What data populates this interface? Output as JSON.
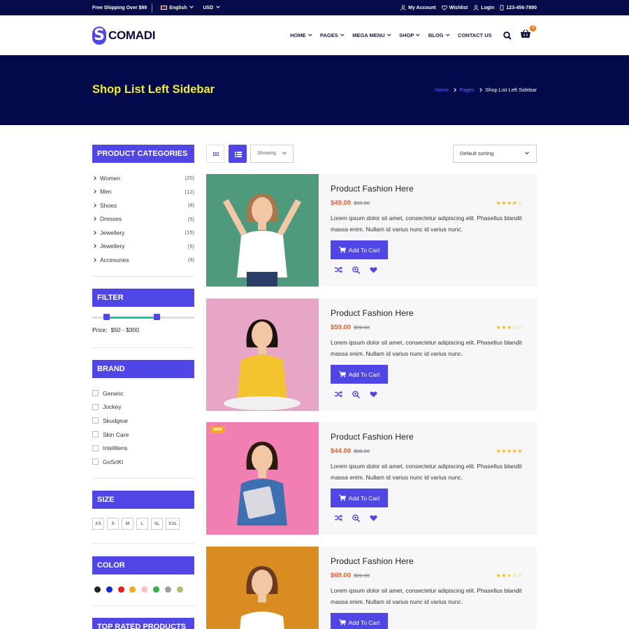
{
  "topbar": {
    "shipping": "Free Shipping Over $99",
    "language": "English",
    "currency": "USD",
    "my_account": "My Account",
    "wishlist": "Wishlist",
    "login": "Login",
    "phone": "123-456-7890"
  },
  "header": {
    "logo_letter": "S",
    "logo_text": "COMADI",
    "nav": [
      {
        "label": "HOME",
        "dropdown": true
      },
      {
        "label": "PAGES",
        "dropdown": true
      },
      {
        "label": "MEGA MENU",
        "dropdown": true
      },
      {
        "label": "SHOP",
        "dropdown": true
      },
      {
        "label": "BLOG",
        "dropdown": true
      },
      {
        "label": "CONTACT US",
        "dropdown": false
      }
    ],
    "cart_count": "3",
    "icons": [
      "search-icon",
      "basket-icon"
    ]
  },
  "banner": {
    "title": "Shop List Left Sidebar",
    "breadcrumb": [
      "Home",
      "Pages",
      "Shop List Left Sidebar"
    ],
    "title_color": "#f1ec3c"
  },
  "sidebar": {
    "categories_title": "PRODUCT CATEGORIES",
    "categories": [
      {
        "label": "Women",
        "count": "(20)"
      },
      {
        "label": "Men",
        "count": "(12)"
      },
      {
        "label": "Shoes",
        "count": "(8)"
      },
      {
        "label": "Dresses",
        "count": "(5)"
      },
      {
        "label": "Jewellery",
        "count": "(15)"
      },
      {
        "label": "Jewellery",
        "count": "(5)"
      },
      {
        "label": "Accesories",
        "count": "(9)"
      }
    ],
    "filter_title": "FILTER",
    "price_label": "Price:",
    "price_range": "$50 - $300",
    "brand_title": "BRAND",
    "brands": [
      "Generic",
      "Jockey",
      "Skudgear",
      "Skin Care",
      "Intellilens",
      "GoSriKi"
    ],
    "size_title": "SIZE",
    "sizes": [
      "XS",
      "S",
      "M",
      "L",
      "XL",
      "XXL"
    ],
    "color_title": "COLOR",
    "colors": [
      "#222222",
      "#1426d6",
      "#e61b1b",
      "#f5a623",
      "#f9c0c8",
      "#2fb344",
      "#9e9e9e",
      "#b9b870"
    ],
    "top_rated_title": "TOP RATED PRODUCTS"
  },
  "toolbar": {
    "showing": "Showing",
    "sort": "Default sorting",
    "views": [
      "grid-view",
      "list-view"
    ],
    "active_view": "list-view"
  },
  "products": [
    {
      "name": "Product Fashion Here",
      "price": "$49.00",
      "old_price": "$59.00",
      "rating": 4,
      "desc": "Lorem ipsum dolor sit amet, consectetur adipiscing elit. Phasellus blandit massa enim. Nullam id varius nunc id varius nunc.",
      "cta": "Add To Cart",
      "badge": "",
      "bg": "#4f9a7c"
    },
    {
      "name": "Product Fashion Here",
      "price": "$59.00",
      "old_price": "$99.00",
      "rating": 3,
      "desc": "Lorem ipsum dolor sit amet, consectetur adipiscing elit. Phasellus blandit massa enim. Nullam id varius nunc id varius nunc.",
      "cta": "Add To Cart",
      "badge": "",
      "bg": "#e8a6c6"
    },
    {
      "name": "Product Fashion Here",
      "price": "$44.00",
      "old_price": "$88.00",
      "rating": 5,
      "desc": "Lorem ipsum dolor sit amet, consectetur adipiscing elit. Phasellus blandit massa enim. Nullam id varius nunc id varius nunc.",
      "cta": "Add To Cart",
      "badge": "NEW",
      "bg": "#f27fb4"
    },
    {
      "name": "Product Fashion Here",
      "price": "$69.00",
      "old_price": "$89.00",
      "rating": 2.5,
      "desc": "Lorem ipsum dolor sit amet, consectetur adipiscing elit. Phasellus blandit massa enim. Nullam id varius nunc id varius nunc.",
      "cta": "Add To Cart",
      "badge": "",
      "bg": "#d98c22"
    }
  ],
  "theme": {
    "accent": "#4f46e5",
    "navy": "#030a4b",
    "price": "#f15a22"
  }
}
